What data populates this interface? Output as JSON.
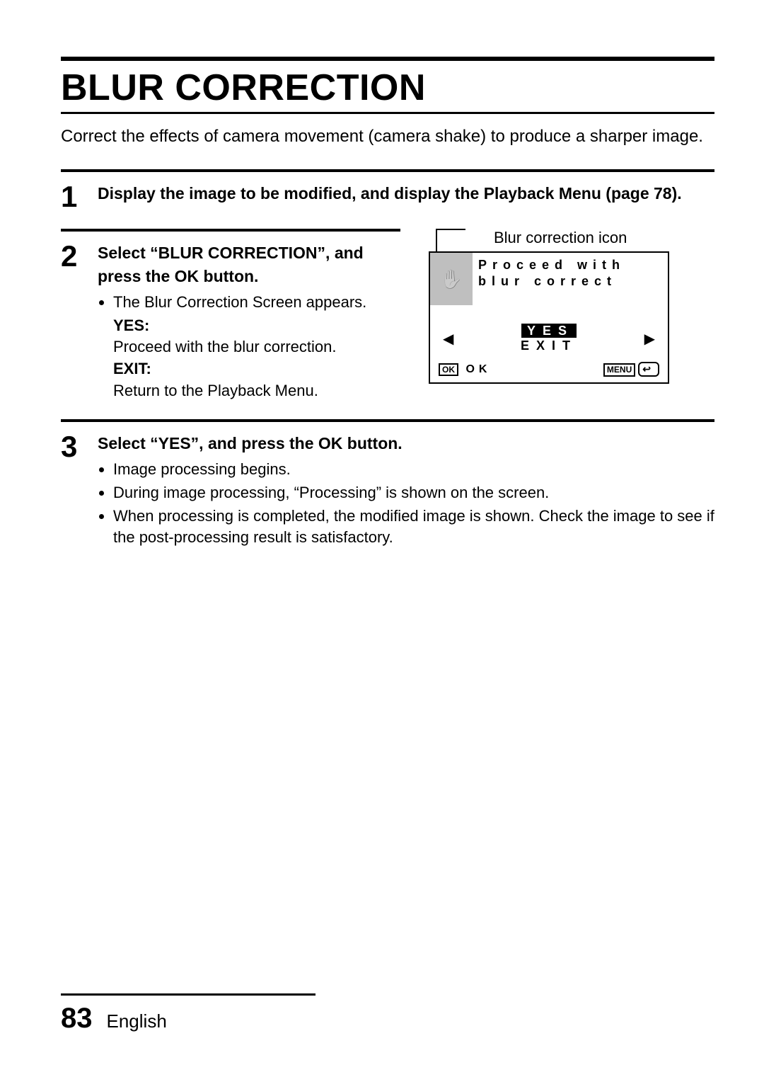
{
  "title": "BLUR CORRECTION",
  "intro": "Correct the effects of camera movement (camera shake) to produce a sharper image.",
  "steps": {
    "s1": {
      "num": "1",
      "head": "Display the image to be modified, and display the Playback Menu (page 78)."
    },
    "s2": {
      "num": "2",
      "head": "Select “BLUR CORRECTION”, and press the OK button.",
      "bullet1": "The Blur Correction Screen appears.",
      "yes_label": "YES:",
      "yes_text": "Proceed with the blur correction.",
      "exit_label": "EXIT:",
      "exit_text": "Return to the Playback Menu."
    },
    "s3": {
      "num": "3",
      "head": "Select “YES”, and press the OK button.",
      "b1": "Image processing begins.",
      "b2": "During image processing, “Processing” is shown on the screen.",
      "b3": "When processing is completed, the modified image is shown. Check the image to see if the post-processing result is satisfactory."
    }
  },
  "figure": {
    "caption": "Blur correction icon",
    "prompt_line1": "Proceed with",
    "prompt_line2": "blur correct",
    "hand_glyph": "✋",
    "left_arrow": "◀",
    "right_arrow": "▶",
    "opt_yes": "YES",
    "opt_exit": "EXIT",
    "ok_box": "OK",
    "ok_text": "OK",
    "menu_box": "MENU",
    "return_glyph": "↩"
  },
  "footer": {
    "page": "83",
    "lang": "English"
  }
}
